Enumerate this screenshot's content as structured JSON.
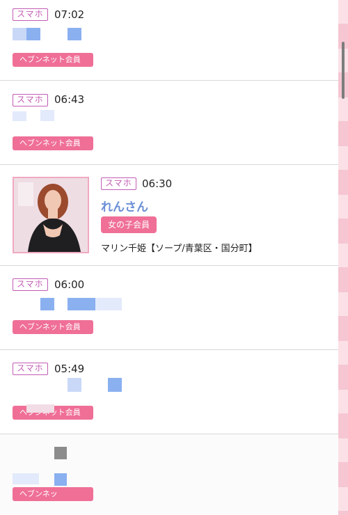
{
  "feed": {
    "items": [
      {
        "device": "スマホ",
        "time": "07:02",
        "badge": "ヘブンネット会員"
      },
      {
        "device": "スマホ",
        "time": "06:43",
        "badge": "ヘブンネット会員"
      },
      {
        "device": "スマホ",
        "time": "06:30",
        "name": "れんさん",
        "badge": "女の子会員",
        "shop": "マリン千姫【ソープ/青葉区・国分町】"
      },
      {
        "device": "スマホ",
        "time": "06:00",
        "badge": "ヘブンネット会員"
      },
      {
        "device": "スマホ",
        "time": "05:49",
        "badge": "ヘブンネット会員"
      },
      {
        "badge": "ヘブンネッ"
      }
    ]
  },
  "colors": {
    "accent_pink": "#ef6f97",
    "device_purple": "#c25bb4",
    "name_blue": "#6b8fd6"
  },
  "icons": {
    "scrollbar": "scrollbar-thumb"
  }
}
